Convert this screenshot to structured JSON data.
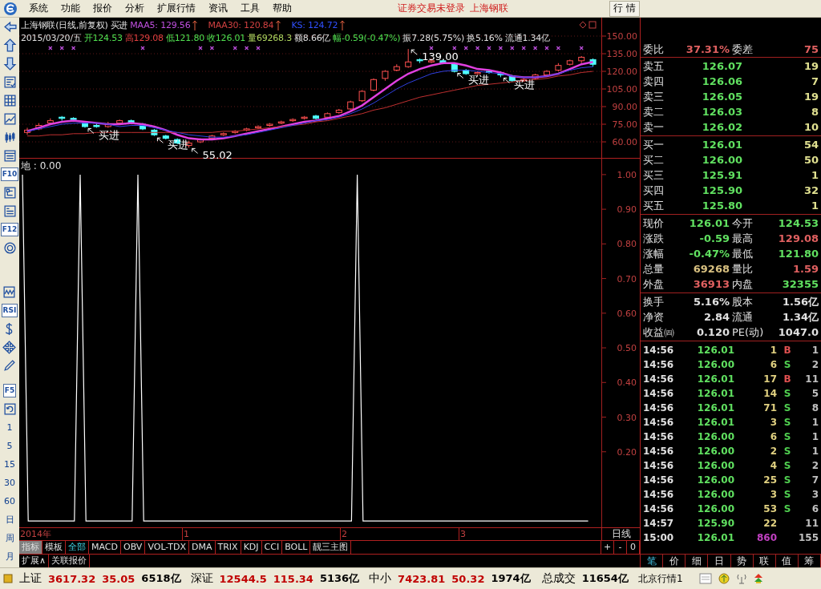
{
  "menu": {
    "items": [
      "系统",
      "功能",
      "报价",
      "分析",
      "扩展行情",
      "资讯",
      "工具",
      "帮助"
    ],
    "notice": "证券交易未登录",
    "stock": "上海钢联",
    "tab": "行 情"
  },
  "toolbar": {
    "groups": [
      [
        {
          "kind": "icon"
        },
        {
          "kind": "icon"
        },
        {
          "kind": "icon"
        },
        {
          "kind": "icon"
        },
        {
          "kind": "icon"
        },
        {
          "kind": "icon"
        },
        {
          "kind": "icon"
        },
        {
          "kind": "icon"
        },
        {
          "kind": "text",
          "text": "F10"
        },
        {
          "kind": "icon"
        },
        {
          "kind": "icon"
        },
        {
          "kind": "text",
          "text": "F12"
        },
        {
          "kind": "icon"
        }
      ],
      [
        {
          "kind": "icon"
        },
        {
          "kind": "text",
          "text": "RSI"
        },
        {
          "kind": "icon"
        },
        {
          "kind": "icon"
        },
        {
          "kind": "icon"
        }
      ],
      [
        {
          "kind": "text",
          "text": "F5"
        },
        {
          "kind": "icon"
        },
        {
          "kind": "key",
          "text": "1"
        },
        {
          "kind": "key",
          "text": "5"
        },
        {
          "kind": "key",
          "text": "15"
        },
        {
          "kind": "key",
          "text": "30"
        },
        {
          "kind": "key",
          "text": "60"
        },
        {
          "kind": "key",
          "text": "日"
        },
        {
          "kind": "key",
          "text": "周"
        },
        {
          "kind": "key",
          "text": "月"
        }
      ]
    ]
  },
  "price_chart": {
    "title": "上海钢联(日线,前复权)",
    "signal": "买进",
    "indicators": [
      {
        "text": "MAA5: 129.56",
        "color": "#c050e0"
      },
      {
        "text": "MAA30: 120.84",
        "color": "#d04040"
      },
      {
        "text": "KS: 124.72",
        "color": "#3050ff"
      }
    ],
    "annotations": [
      "买进",
      "买进",
      "55.02",
      "139.00",
      "买进",
      "买进"
    ],
    "quote": [
      {
        "text": "2015/03/20/五",
        "color": "#e0e0e0"
      },
      {
        "text": "开124.53",
        "color": "#50e050"
      },
      {
        "text": "高129.08",
        "color": "#e04040"
      },
      {
        "text": "低121.80",
        "color": "#50e050"
      },
      {
        "text": "收126.01",
        "color": "#50e050"
      },
      {
        "text": "量69268.3",
        "color": "#b0d860"
      },
      {
        "text": "额8.66亿",
        "color": "#e0e0e0"
      },
      {
        "text": "幅-0.59(-0.47%)",
        "color": "#50e050"
      },
      {
        "text": "振7.28(5.75%)",
        "color": "#e0e0e0"
      },
      {
        "text": "换5.16%",
        "color": "#e0e0e0"
      },
      {
        "text": "流通1.34亿",
        "color": "#e0e0e0"
      }
    ],
    "chart_data": {
      "type": "candlestick",
      "grid": true,
      "ylim": [
        45.7,
        165.7
      ],
      "yticks": [
        {
          "value": 150,
          "label": "150.00"
        },
        {
          "value": 135,
          "label": "135.00"
        },
        {
          "value": 120,
          "label": "120.00"
        },
        {
          "value": 105,
          "label": "105.00"
        },
        {
          "value": 90,
          "label": "90.00"
        },
        {
          "value": 75,
          "label": "75.00"
        },
        {
          "value": 60,
          "label": "60.00"
        }
      ],
      "ohlc": [
        [
          68,
          72,
          66,
          70
        ],
        [
          71,
          76,
          70,
          74
        ],
        [
          76,
          80,
          75,
          78
        ],
        [
          81,
          82,
          78,
          80
        ],
        [
          80,
          81,
          77,
          79
        ],
        [
          76,
          77,
          72,
          73
        ],
        [
          74,
          76,
          72,
          73
        ],
        [
          73,
          77,
          72,
          75
        ],
        [
          76,
          79,
          75,
          78
        ],
        [
          78,
          79,
          75,
          76
        ],
        [
          75,
          76,
          70,
          71
        ],
        [
          70,
          71,
          65,
          66
        ],
        [
          65,
          66,
          62,
          63
        ],
        [
          62,
          63,
          58,
          59
        ],
        [
          57,
          61,
          55,
          59
        ],
        [
          60,
          63,
          59,
          62
        ],
        [
          63,
          66,
          62,
          65
        ],
        [
          66,
          68,
          65,
          67
        ],
        [
          68,
          70,
          67,
          69
        ],
        [
          70,
          72,
          69,
          71
        ],
        [
          72,
          74,
          71,
          73
        ],
        [
          74,
          76,
          73,
          75
        ],
        [
          76,
          78,
          75,
          77
        ],
        [
          78,
          80,
          77,
          79
        ],
        [
          80,
          82,
          79,
          81
        ],
        [
          82,
          83,
          79,
          80
        ],
        [
          81,
          85,
          80,
          84
        ],
        [
          85,
          88,
          84,
          87
        ],
        [
          88,
          95,
          87,
          94
        ],
        [
          95,
          104,
          94,
          103
        ],
        [
          104,
          114,
          103,
          113
        ],
        [
          114,
          121,
          112,
          120
        ],
        [
          121,
          126,
          120,
          124
        ],
        [
          124,
          139,
          123,
          128
        ],
        [
          130,
          131,
          127,
          129
        ],
        [
          128,
          131,
          127,
          129
        ],
        [
          129,
          130,
          126,
          127
        ],
        [
          126,
          127,
          119,
          120
        ],
        [
          121,
          122,
          117,
          118
        ],
        [
          118,
          120,
          117,
          119
        ],
        [
          120,
          121,
          118,
          119
        ],
        [
          119,
          120,
          115,
          117
        ],
        [
          116,
          117,
          111,
          112
        ],
        [
          112,
          114,
          111,
          113
        ],
        [
          114,
          118,
          113,
          117
        ],
        [
          117,
          121,
          116,
          120
        ],
        [
          121,
          127,
          120,
          125
        ],
        [
          126,
          130,
          125,
          129
        ],
        [
          129,
          133,
          127,
          132
        ],
        [
          130,
          131,
          124,
          126
        ]
      ],
      "series": [
        {
          "type": "line",
          "color": "#e040e0",
          "values": [
            69,
            72,
            75,
            77,
            78,
            77,
            76,
            75,
            75,
            76,
            75,
            73,
            70,
            66,
            63,
            62,
            62,
            63,
            65,
            67,
            69,
            71,
            73,
            75,
            77,
            78,
            80,
            82,
            86,
            91,
            98,
            105,
            112,
            118,
            122,
            125,
            127,
            127,
            125,
            122,
            121,
            119,
            116,
            115,
            115,
            116,
            118,
            122,
            126,
            128
          ]
        },
        {
          "type": "line",
          "color": "#c03030",
          "values": [
            65,
            65,
            66,
            66,
            67,
            67,
            68,
            68,
            68,
            68,
            68,
            68,
            68,
            68,
            68,
            68,
            68,
            69,
            69,
            70,
            71,
            72,
            73,
            74,
            75,
            77,
            78,
            80,
            82,
            84,
            87,
            89,
            92,
            95,
            98,
            100,
            102,
            104,
            106,
            108,
            109,
            110,
            111,
            112,
            113,
            114,
            116,
            117,
            119,
            120
          ]
        },
        {
          "type": "line",
          "color": "#3040e0",
          "values": [
            69,
            71,
            73,
            75,
            76,
            76,
            76,
            75,
            73,
            74,
            74,
            72,
            70,
            68,
            66,
            65,
            64,
            64,
            65,
            66,
            68,
            70,
            72,
            74,
            76,
            78,
            79,
            81,
            84,
            88,
            93,
            99,
            105,
            110,
            114,
            118,
            120,
            121,
            121,
            120,
            119,
            118,
            116,
            115,
            115,
            116,
            118,
            121,
            123,
            124
          ]
        }
      ]
    }
  },
  "indicator_chart": {
    "label": "地 : 0.00",
    "chart_data": {
      "type": "line",
      "ylim": [
        -0.018,
        1.046
      ],
      "yticks": [
        {
          "value": 1,
          "label": "1.00"
        },
        {
          "value": 0.9,
          "label": "0.90"
        },
        {
          "value": 0.8,
          "label": "0.80"
        },
        {
          "value": 0.7,
          "label": "0.70"
        },
        {
          "value": 0.6,
          "label": "0.60"
        },
        {
          "value": 0.5,
          "label": "0.50"
        },
        {
          "value": 0.4,
          "label": "0.40"
        },
        {
          "value": 0.3,
          "label": "0.30"
        },
        {
          "value": 0.2,
          "label": "0.20"
        }
      ],
      "series": [
        {
          "color": "#ffffff",
          "values": [
            1,
            0,
            0,
            0,
            0,
            0,
            0,
            0,
            0,
            0,
            1,
            0,
            0,
            0,
            0,
            0,
            0,
            0,
            0,
            0,
            1,
            0,
            0,
            0,
            0,
            0,
            0,
            0,
            0,
            0,
            0,
            0,
            0,
            0,
            0,
            0,
            0,
            0,
            0,
            0,
            0,
            0,
            0,
            0,
            0,
            0,
            0,
            0,
            0,
            0,
            0,
            0,
            0,
            0,
            0,
            0,
            0,
            0,
            1,
            0,
            0,
            0,
            0,
            0,
            0,
            0,
            0,
            0,
            0,
            0,
            0,
            0,
            0,
            0,
            0,
            0,
            0,
            0,
            0,
            0,
            0,
            0,
            0,
            0,
            0,
            0,
            0,
            0,
            0,
            0,
            0,
            0,
            0,
            0,
            0,
            0,
            0,
            0,
            0
          ]
        }
      ]
    }
  },
  "time_axis": {
    "labels": [
      "2014年",
      "1",
      "2",
      "3"
    ],
    "period": "日线"
  },
  "mode_tabs": [
    {
      "label": "指标",
      "selected": true
    },
    {
      "label": "模板",
      "selected": false
    }
  ],
  "indicator_tabs": [
    {
      "label": "全部",
      "selected": true
    },
    {
      "label": "MACD",
      "selected": false
    },
    {
      "label": "OBV",
      "selected": false
    },
    {
      "label": "VOL-TDX",
      "selected": false
    },
    {
      "label": "DMA",
      "selected": false
    },
    {
      "label": "TRIX",
      "selected": false
    },
    {
      "label": "KDJ",
      "selected": false
    },
    {
      "label": "CCI",
      "selected": false
    },
    {
      "label": "BOLL",
      "selected": false
    },
    {
      "label": "靓三主图",
      "selected": false
    }
  ],
  "zoom_buttons": [
    "+",
    "-",
    "0"
  ],
  "bottom_tabs": [
    "扩展∧",
    "关联报价"
  ],
  "order_book": {
    "ratio_label": "委比",
    "ratio": "37.31%",
    "diff_label": "委差",
    "diff": "75",
    "asks": [
      {
        "label": "卖五",
        "price": "126.07",
        "volume": "19"
      },
      {
        "label": "卖四",
        "price": "126.06",
        "volume": "7"
      },
      {
        "label": "卖三",
        "price": "126.05",
        "volume": "19"
      },
      {
        "label": "卖二",
        "price": "126.03",
        "volume": "8"
      },
      {
        "label": "卖一",
        "price": "126.02",
        "volume": "10"
      }
    ],
    "bids": [
      {
        "label": "买一",
        "price": "126.01",
        "volume": "54"
      },
      {
        "label": "买二",
        "price": "126.00",
        "volume": "50"
      },
      {
        "label": "买三",
        "price": "125.91",
        "volume": "1"
      },
      {
        "label": "买四",
        "price": "125.90",
        "volume": "32"
      },
      {
        "label": "买五",
        "price": "125.80",
        "volume": "1"
      }
    ]
  },
  "stats": [
    [
      {
        "label": "现价",
        "value": "126.01",
        "color": "#60e060"
      },
      {
        "label": "今开",
        "value": "124.53",
        "color": "#60e060"
      }
    ],
    [
      {
        "label": "涨跌",
        "value": "-0.59",
        "color": "#60e060"
      },
      {
        "label": "最高",
        "value": "129.08",
        "color": "#e06060"
      }
    ],
    [
      {
        "label": "涨幅",
        "value": "-0.47%",
        "color": "#60e060"
      },
      {
        "label": "最低",
        "value": "121.80",
        "color": "#60e060"
      }
    ],
    [
      {
        "label": "总量",
        "value": "69268",
        "color": "#d8c080"
      },
      {
        "label": "量比",
        "value": "1.59",
        "color": "#e06060"
      }
    ],
    [
      {
        "label": "外盘",
        "value": "36913",
        "color": "#e06060"
      },
      {
        "label": "内盘",
        "value": "32355",
        "color": "#60e060"
      }
    ]
  ],
  "finance": [
    [
      {
        "label": "换手",
        "value": "5.16%"
      },
      {
        "label": "股本",
        "value": "1.56亿"
      }
    ],
    [
      {
        "label": "净资",
        "value": "2.84"
      },
      {
        "label": "流通",
        "value": "1.34亿"
      }
    ],
    [
      {
        "label": "收益㈣",
        "value": "0.120"
      },
      {
        "label": "PE(动)",
        "value": "1047.0"
      }
    ]
  ],
  "trades": [
    {
      "time": "14:56",
      "price": "126.01",
      "volume": "1",
      "side": "B",
      "count": "1",
      "big": false
    },
    {
      "time": "14:56",
      "price": "126.00",
      "volume": "6",
      "side": "S",
      "count": "2",
      "big": false
    },
    {
      "time": "14:56",
      "price": "126.01",
      "volume": "17",
      "side": "B",
      "count": "11",
      "big": false
    },
    {
      "time": "14:56",
      "price": "126.01",
      "volume": "14",
      "side": "S",
      "count": "5",
      "big": false
    },
    {
      "time": "14:56",
      "price": "126.01",
      "volume": "71",
      "side": "S",
      "count": "8",
      "big": false
    },
    {
      "time": "14:56",
      "price": "126.01",
      "volume": "3",
      "side": "S",
      "count": "1",
      "big": false
    },
    {
      "time": "14:56",
      "price": "126.00",
      "volume": "6",
      "side": "S",
      "count": "1",
      "big": false
    },
    {
      "time": "14:56",
      "price": "126.00",
      "volume": "2",
      "side": "S",
      "count": "1",
      "big": false
    },
    {
      "time": "14:56",
      "price": "126.00",
      "volume": "4",
      "side": "S",
      "count": "2",
      "big": false
    },
    {
      "time": "14:56",
      "price": "126.00",
      "volume": "25",
      "side": "S",
      "count": "7",
      "big": false
    },
    {
      "time": "14:56",
      "price": "126.00",
      "volume": "3",
      "side": "S",
      "count": "3",
      "big": false
    },
    {
      "time": "14:56",
      "price": "126.00",
      "volume": "53",
      "side": "S",
      "count": "6",
      "big": false
    },
    {
      "time": "14:57",
      "price": "125.90",
      "volume": "22",
      "count": "11",
      "big": false
    },
    {
      "time": "15:00",
      "price": "126.01",
      "volume": "860",
      "count": "155",
      "big": true
    }
  ],
  "panel_tabs": [
    {
      "label": "笔",
      "selected": true
    },
    {
      "label": "价",
      "selected": false
    },
    {
      "label": "细",
      "selected": false
    },
    {
      "label": "日",
      "selected": false
    },
    {
      "label": "势",
      "selected": false
    },
    {
      "label": "联",
      "selected": false
    },
    {
      "label": "值",
      "selected": false
    },
    {
      "label": "筹",
      "selected": false
    }
  ],
  "status_bar": {
    "indices": [
      {
        "name": "上证",
        "value": "3617.32",
        "change": "35.05",
        "amount": "6518亿"
      },
      {
        "name": "深证",
        "value": "12544.5",
        "change": "115.34",
        "amount": "5136亿"
      },
      {
        "name": "中小",
        "value": "7423.81",
        "change": "50.32",
        "amount": "1974亿"
      }
    ],
    "total_label": "总成交",
    "total": "11654亿",
    "server": "北京行情1"
  }
}
